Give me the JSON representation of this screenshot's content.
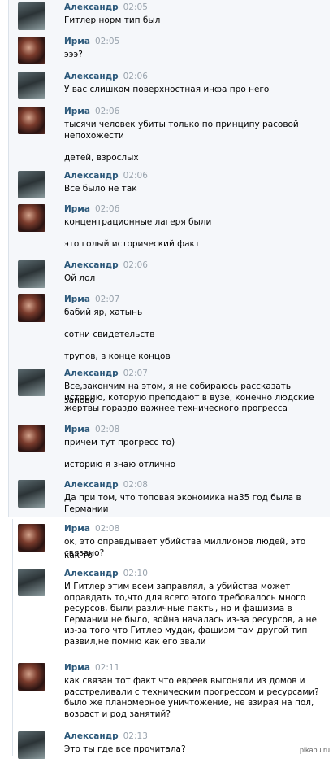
{
  "messages": [
    {
      "author": "Александр",
      "time": "02:05",
      "avatar": "sasha-avatar",
      "lines": [
        "Гитлер норм тип был"
      ]
    },
    {
      "author": "Ирма",
      "time": "02:05",
      "avatar": "irma-avatar",
      "lines": [
        "эээ?"
      ]
    },
    {
      "author": "Александр",
      "time": "02:06",
      "avatar": "sasha-avatar",
      "lines": [
        "У вас слишком поверхностная инфа про него"
      ]
    },
    {
      "author": "Ирма",
      "time": "02:06",
      "avatar": "irma-avatar",
      "lines": [
        "тысячи человек убиты только по принципу расовой",
        "непохожести",
        "",
        "детей, взрослых"
      ]
    },
    {
      "author": "Александр",
      "time": "02:06",
      "avatar": "sasha-avatar",
      "lines": [
        "Все было не так"
      ]
    },
    {
      "author": "Ирма",
      "time": "02:06",
      "avatar": "irma-avatar",
      "lines": [
        "концентрационные лагеря были",
        "",
        "это голый исторический факт"
      ]
    },
    {
      "author": "Александр",
      "time": "02:06",
      "avatar": "sasha-avatar",
      "lines": [
        "Ой лол"
      ]
    },
    {
      "author": "Ирма",
      "time": "02:07",
      "avatar": "irma-avatar",
      "lines": [
        "бабий яр, хатынь",
        "",
        "сотни свидетельств",
        "",
        "трупов, в конце концов"
      ]
    },
    {
      "author": "Александр",
      "time": "02:07",
      "avatar": "sasha-avatar",
      "lines": [
        "Все,закончим на этом, я не собираюсь рассказать заново",
        "историю, которую преподают в вузе, конечно людские",
        "жертвы гораздо важнее технического прогресса"
      ]
    },
    {
      "author": "Ирма",
      "time": "02:08",
      "avatar": "irma-avatar",
      "lines": [
        "причем тут прогресс то)",
        "",
        "историю я знаю отлично"
      ]
    },
    {
      "author": "Александр",
      "time": "02:08",
      "avatar": "sasha-avatar",
      "lines": [
        "Да при том, что топовая экономика на35 год была в",
        "Германии"
      ]
    },
    {
      "author": "Ирма",
      "time": "02:08",
      "avatar": "irma-avatar",
      "lines": [
        "ок, это оправдывает убийства миллионов людей, это как то",
        "связано?"
      ]
    },
    {
      "author": "Александр",
      "time": "02:10",
      "avatar": "sasha-avatar",
      "lines": [
        "И Гитлер этим всем заправлял, а убийства может",
        "оправдать то,что для всего этого требовалось много",
        "ресурсов, были различные пакты, но и фашизма в",
        "Германии не было, война началась из-за ресурсов, а не",
        "из-за того что Гитлер мудак, фашизм там другой тип",
        "развил,не помню как его звали"
      ]
    },
    {
      "author": "Ирма",
      "time": "02:11",
      "avatar": "irma-avatar",
      "lines": [
        "как связан тот факт что евреев выгоняли из домов и",
        "расстреливали с техническим прогрессом и ресурсами?",
        "было же планомерное уничтожение, не взирая на пол,",
        "возраст и род занятий?"
      ]
    },
    {
      "author": "Александр",
      "time": "02:13",
      "avatar": "sasha-avatar",
      "lines": [
        "Это ты где все прочитала?"
      ]
    }
  ],
  "watermark": "pikabu.ru"
}
